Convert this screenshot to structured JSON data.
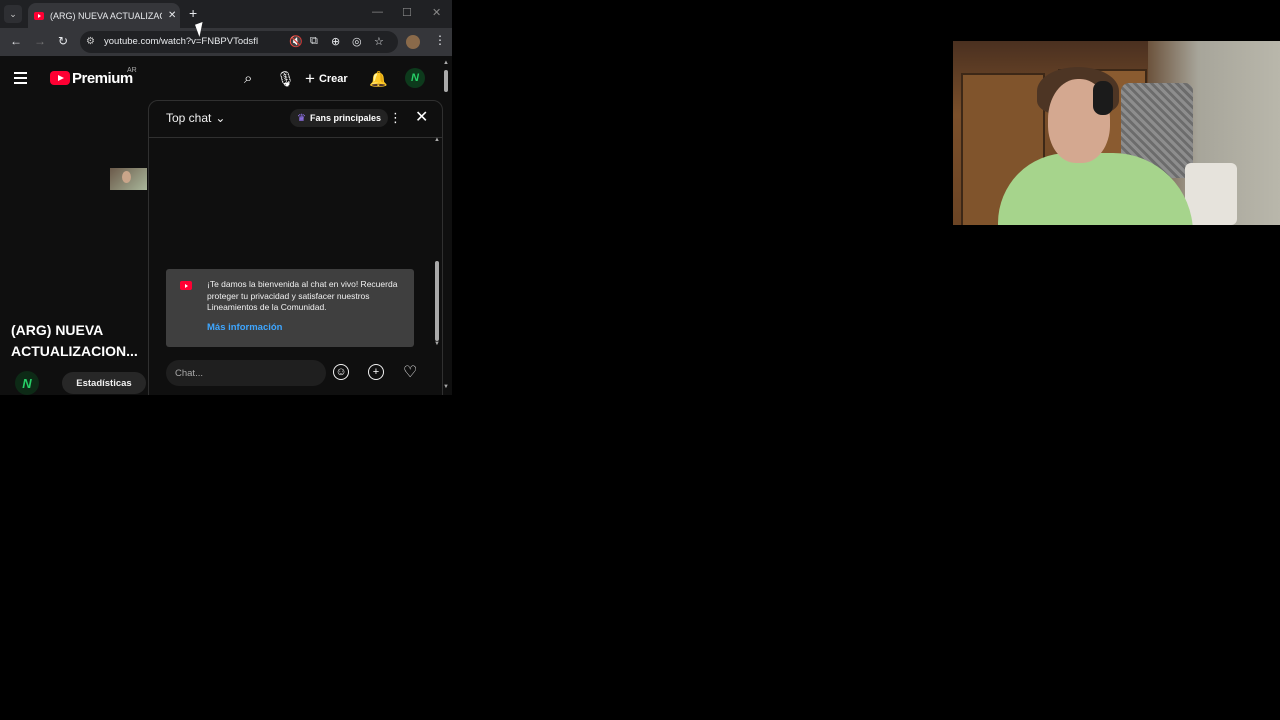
{
  "browser": {
    "tab_title": "(ARG) NUEVA ACTUALIZACION",
    "url": "youtube.com/watch?v=FNBPVTodsfI",
    "new_tab_symbol": "+"
  },
  "youtube": {
    "logo_text": "Premium",
    "region": "AR",
    "create_label": "Crear",
    "avatar_letter": "N",
    "video_title": "(ARG) NUEVA ACTUALIZACION...",
    "channel_initial": "N",
    "chip_label": "Estadísticas"
  },
  "chat": {
    "mode_label": "Top chat",
    "fans_label": "Fans principales",
    "welcome_text": "¡Te damos la bienvenida al chat en vivo! Recuerda proteger tu privacidad y satisfacer nuestros Lineamientos de la Comunidad.",
    "more_info": "Más información",
    "input_placeholder": "Chat..."
  },
  "colors": {
    "youtube_red": "#ff0033",
    "link_blue": "#3ea6ff",
    "channel_green": "#27d067"
  },
  "icons": [
    "tab-list-icon",
    "youtube-favicon",
    "close-icon",
    "back-icon",
    "forward-icon",
    "reload-icon",
    "site-info-icon",
    "mute-icon",
    "install-icon",
    "zoom-icon",
    "eye-off-icon",
    "star-icon",
    "kebab-icon",
    "hamburger-icon",
    "search-icon",
    "mic-icon",
    "plus-icon",
    "bell-icon",
    "crown-icon",
    "chevron-down-icon",
    "emoji-icon",
    "heart-icon"
  ]
}
